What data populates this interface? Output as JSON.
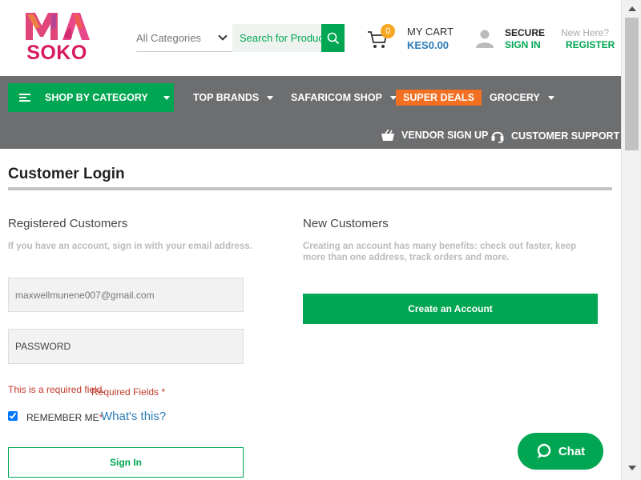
{
  "header": {
    "logo_top": "MA",
    "logo_bottom": "SOKO",
    "category_select": "All Categories",
    "search_placeholder": "Search for Products",
    "cart": {
      "count": "0",
      "label": "MY CART",
      "total": "KES0.00"
    },
    "account": {
      "secure": "SECURE",
      "sign_in": "SIGN IN",
      "new_here": "New Here?",
      "register": "REGISTER"
    }
  },
  "nav": {
    "shop_by_category": "SHOP BY CATEGORY",
    "items": [
      "TOP BRANDS",
      "SAFARICOM SHOP",
      "SUPER DEALS",
      "GROCERY"
    ],
    "vendor_signup": "VENDOR SIGN UP",
    "customer_support": "CUSTOMER SUPPORT"
  },
  "main": {
    "title": "Customer Login",
    "registered": {
      "title": "Registered Customers",
      "description": "If you have an account, sign in with your email address.",
      "email_value": "maxwellmunene007@gmail.com",
      "password_placeholder": "PASSWORD",
      "error_text": "This is a required field.",
      "required_fields": "Required Fields *",
      "remember_me": "REMEMBER ME",
      "remember_star": "*",
      "whats_this": "What's this?",
      "sign_in_button": "Sign In"
    },
    "new_customers": {
      "title": "New Customers",
      "description": "Creating an account has many benefits: check out faster, keep more than one address, track orders and more.",
      "create_button": "Create an Account"
    }
  },
  "chat": {
    "label": "Chat"
  },
  "colors": {
    "brand_green": "#00a651",
    "nav_gray": "#6d6e70",
    "deals_orange": "#f36f21",
    "logo_pink": "#d81b60",
    "link_blue": "#2a7ab8"
  },
  "icons": [
    "search-icon",
    "cart-icon",
    "user-icon",
    "menu-icon",
    "basket-icon",
    "headset-icon",
    "chat-icon"
  ]
}
